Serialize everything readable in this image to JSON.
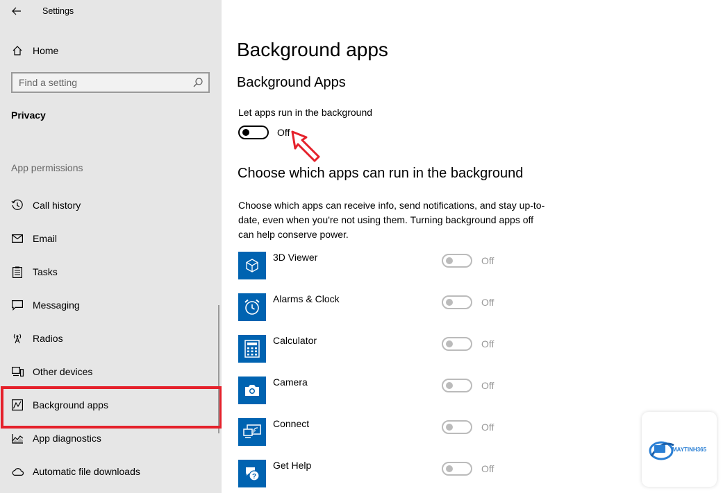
{
  "window": {
    "title": "Settings"
  },
  "sidebar": {
    "home_label": "Home",
    "search_placeholder": "Find a setting",
    "section_title": "Privacy",
    "group_label": "App permissions",
    "items": [
      {
        "label": "Call history",
        "icon": "history-icon"
      },
      {
        "label": "Email",
        "icon": "mail-icon"
      },
      {
        "label": "Tasks",
        "icon": "tasks-icon"
      },
      {
        "label": "Messaging",
        "icon": "chat-icon"
      },
      {
        "label": "Radios",
        "icon": "radio-tower-icon"
      },
      {
        "label": "Other devices",
        "icon": "devices-icon"
      },
      {
        "label": "Background apps",
        "icon": "background-apps-icon",
        "selected": true
      },
      {
        "label": "App diagnostics",
        "icon": "diagnostics-icon"
      },
      {
        "label": "Automatic file downloads",
        "icon": "cloud-icon"
      }
    ]
  },
  "main": {
    "page_title": "Background apps",
    "subhead": "Background Apps",
    "master_toggle": {
      "label": "Let apps run in the background",
      "state": "Off"
    },
    "choose_heading": "Choose which apps can run in the background",
    "choose_description": "Choose which apps can receive info, send notifications, and stay up-to-date, even when you're not using them. Turning background apps off can help conserve power.",
    "apps": [
      {
        "name": "3D Viewer",
        "state": "Off",
        "icon": "cube-icon"
      },
      {
        "name": "Alarms & Clock",
        "state": "Off",
        "icon": "alarm-clock-icon"
      },
      {
        "name": "Calculator",
        "state": "Off",
        "icon": "calculator-icon"
      },
      {
        "name": "Camera",
        "state": "Off",
        "icon": "camera-icon"
      },
      {
        "name": "Connect",
        "state": "Off",
        "icon": "connect-icon"
      },
      {
        "name": "Get Help",
        "state": "Off",
        "icon": "help-icon"
      }
    ]
  },
  "watermark": {
    "brand": "MAYTINH365"
  },
  "colors": {
    "accent": "#0063b1",
    "highlight": "#e5212b",
    "sidebar_bg": "#e6e6e6"
  }
}
